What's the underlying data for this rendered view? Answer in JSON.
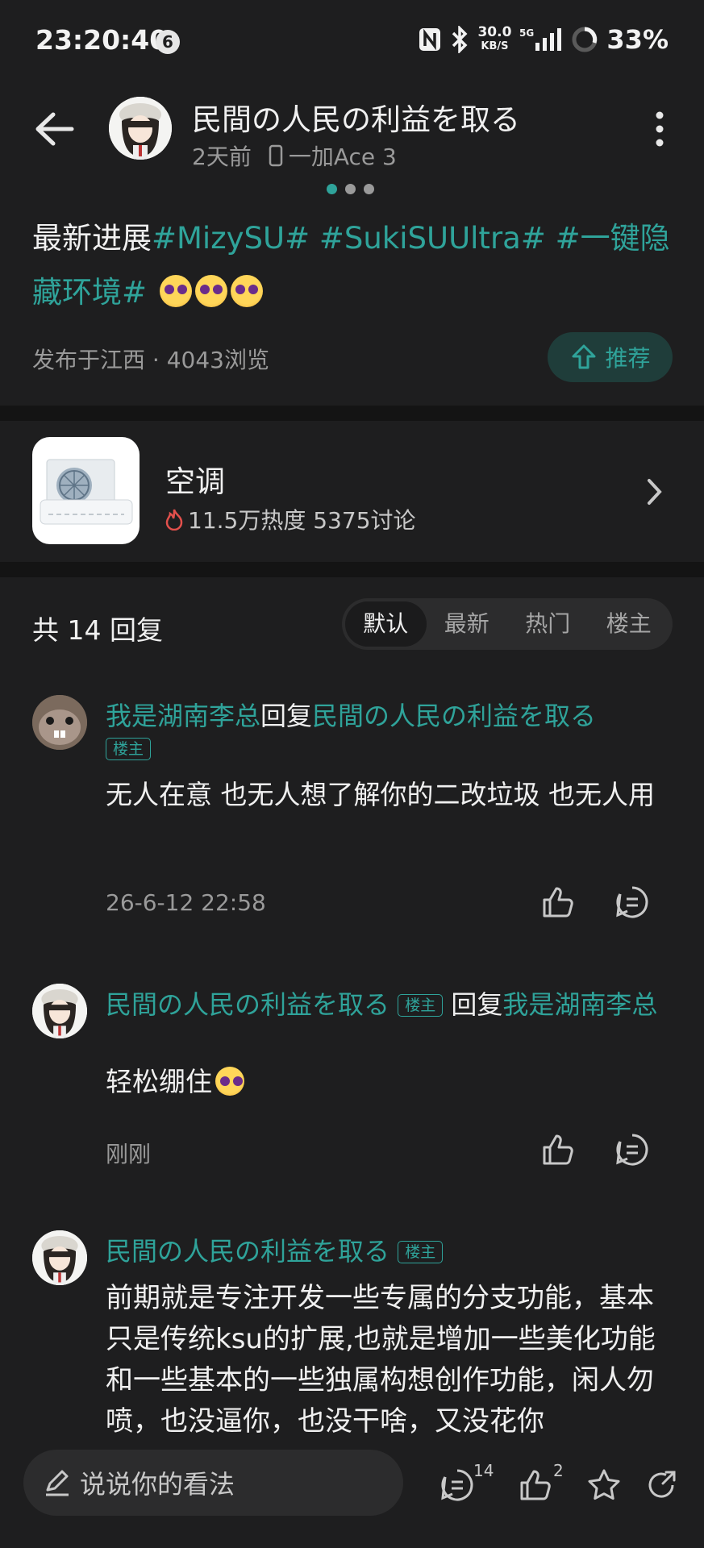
{
  "status": {
    "time": "23:20:40",
    "notif_count": "6",
    "speed_top": "30.0",
    "speed_unit": "KB/S",
    "battery": "33%"
  },
  "header": {
    "title": "民間の人民の利益を取る",
    "time_ago": "2天前",
    "device": "一加Ace 3"
  },
  "post": {
    "lead": "最新进展",
    "tags": [
      "#MizySU#",
      "#SukiSUUltra#",
      "#一键隐藏环境#"
    ],
    "meta": "发布于江西 · 4043浏览",
    "recommend": "推荐"
  },
  "topic": {
    "name": "空调",
    "stats": "11.5万热度 5375讨论"
  },
  "comments_header": {
    "count": "共 14 回复",
    "sort_options": [
      "默认",
      "最新",
      "热门",
      "楼主"
    ]
  },
  "comments": [
    {
      "author": "我是湖南李总",
      "reply_word": "回复",
      "reply_to": "民間の人民の利益を取る",
      "tag": "楼主",
      "text": "无人在意 也无人想了解你的二改垃圾 也无人用",
      "time": "26-6-12 22:58"
    },
    {
      "author": "民間の人民の利益を取る",
      "tag": "楼主",
      "reply_word": "回复",
      "reply_to": "我是湖南李总",
      "text": "轻松绷住",
      "time": "刚刚"
    },
    {
      "author": "民間の人民の利益を取る",
      "tag": "楼主",
      "text": "前期就是专注开发一些专属的分支功能，基本只是传统ksu的扩展,也就是增加一些美化功能和一些基本的一些独属构想创作功能，闲人勿喷，也没逼你，也没干啥，又没花你"
    }
  ],
  "bottom": {
    "placeholder": "说说你的看法",
    "comment_count": "14",
    "like_count": "2"
  },
  "colors": {
    "accent": "#2fa39a",
    "background": "#1e1e1f"
  }
}
